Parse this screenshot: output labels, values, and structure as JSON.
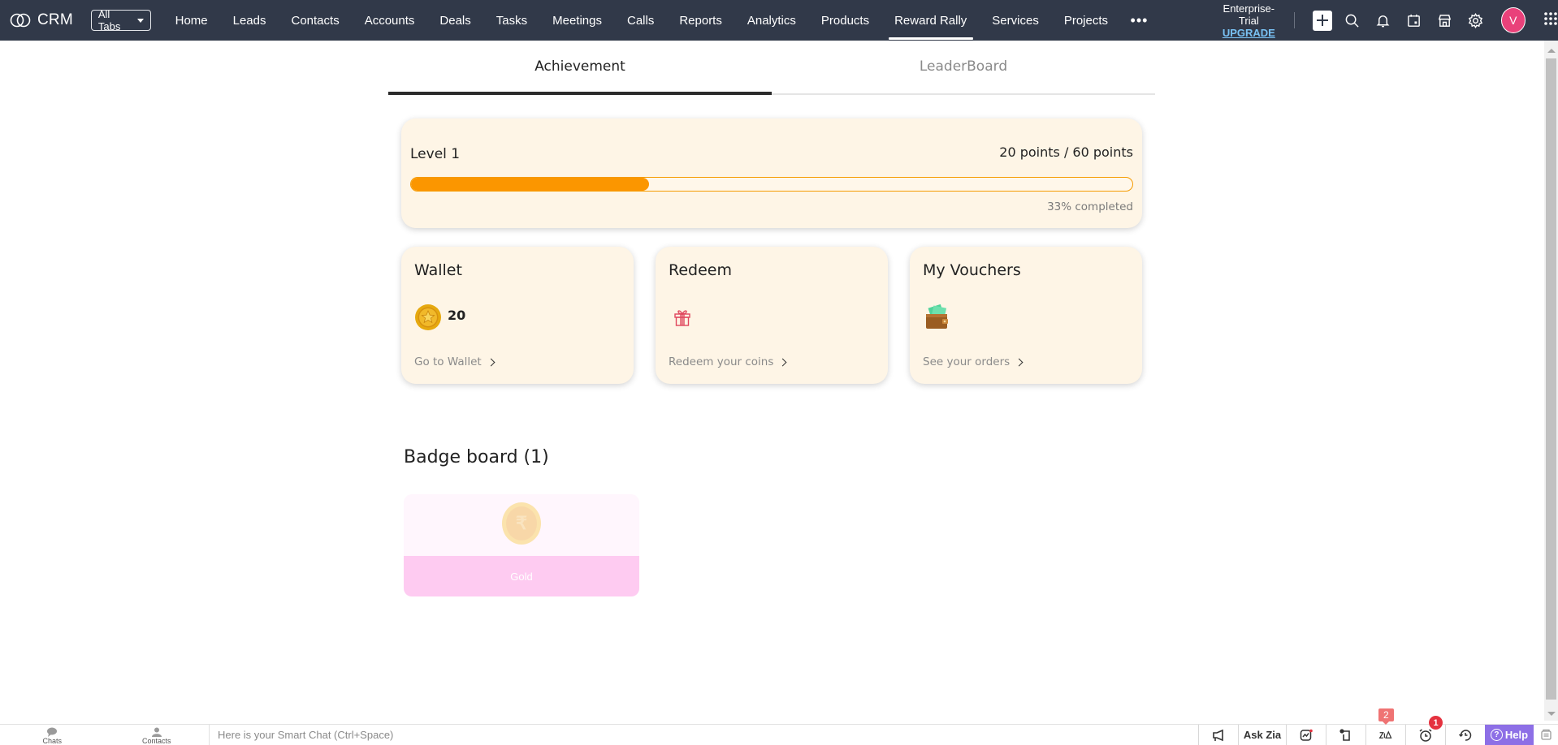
{
  "app": {
    "name": "CRM",
    "all_tabs_label": "All Tabs"
  },
  "nav": {
    "tabs": [
      {
        "label": "Home",
        "active": false
      },
      {
        "label": "Leads",
        "active": false
      },
      {
        "label": "Contacts",
        "active": false
      },
      {
        "label": "Accounts",
        "active": false
      },
      {
        "label": "Deals",
        "active": false
      },
      {
        "label": "Tasks",
        "active": false
      },
      {
        "label": "Meetings",
        "active": false
      },
      {
        "label": "Calls",
        "active": false
      },
      {
        "label": "Reports",
        "active": false
      },
      {
        "label": "Analytics",
        "active": false
      },
      {
        "label": "Products",
        "active": false
      },
      {
        "label": "Reward Rally",
        "active": true
      },
      {
        "label": "Services",
        "active": false
      },
      {
        "label": "Projects",
        "active": false
      }
    ],
    "more_label": "•••",
    "edition": "Enterprise-Trial",
    "upgrade_label": "UPGRADE",
    "icons": [
      "plus-icon",
      "search-icon",
      "bell-icon",
      "calendar-icon",
      "marketplace-icon",
      "gear-icon",
      "avatar",
      "apps-grid-icon"
    ],
    "avatar_initial": "V",
    "avatar_color": "#e9417a"
  },
  "subtabs": [
    {
      "label": "Achievement",
      "active": true
    },
    {
      "label": "LeaderBoard",
      "active": false
    }
  ],
  "level": {
    "title": "Level 1",
    "points_text": "20 points / 60 points",
    "current_points": 20,
    "target_points": 60,
    "progress_percent": 33,
    "completed_text": "33% completed",
    "progress_color": "#fb9600"
  },
  "cards": {
    "wallet": {
      "title": "Wallet",
      "icon": "gold-coin-icon",
      "value": "20",
      "link_label": "Go to Wallet"
    },
    "redeem": {
      "title": "Redeem",
      "icon": "gift-icon",
      "link_label": "Redeem your coins"
    },
    "vouchers": {
      "title": "My Vouchers",
      "icon": "wallet-cash-icon",
      "link_label": "See your orders"
    }
  },
  "badge_board": {
    "title": "Badge board (1)",
    "badges": [
      {
        "label": "Gold",
        "icon": "rupee-coin-icon",
        "symbol": "₹"
      }
    ]
  },
  "bottombar": {
    "chats_label": "Chats",
    "contacts_label": "Contacts",
    "smart_chat_placeholder": "Here is your Smart Chat (Ctrl+Space)",
    "ask_zia_label": "Ask Zia",
    "zia_notification_count": "2",
    "reminder_count": "1",
    "help_label": "Help"
  }
}
